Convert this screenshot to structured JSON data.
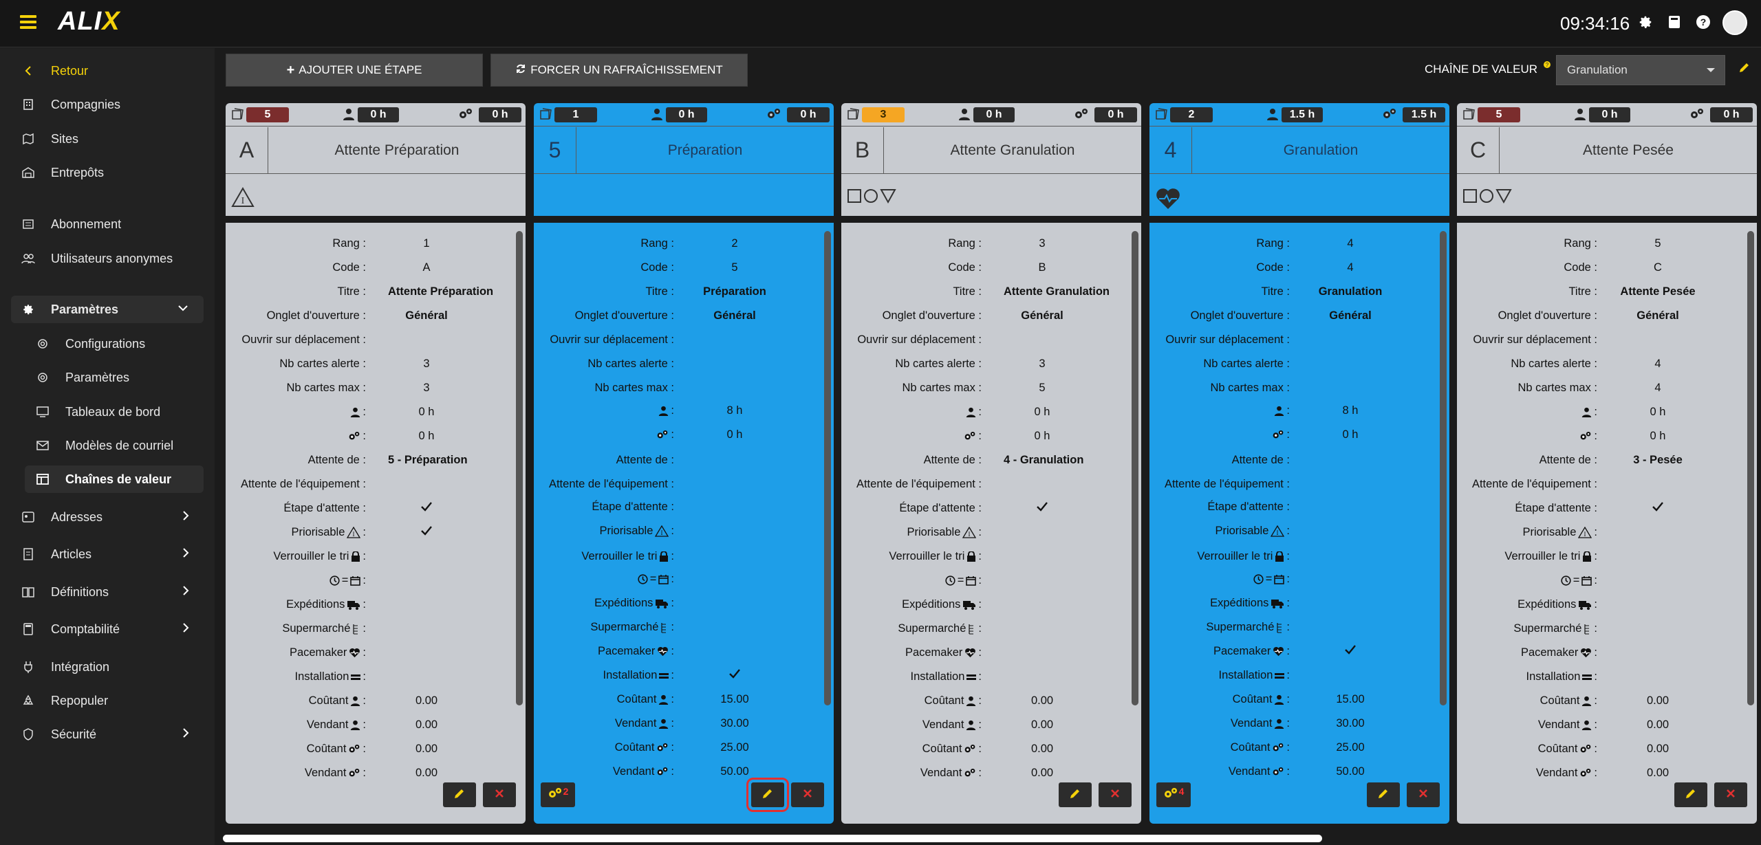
{
  "header": {
    "time": "09:34:16",
    "logo": "ALIX"
  },
  "sidebar": {
    "back": "Retour",
    "items": [
      {
        "label": "Compagnies",
        "icon": "building-icon"
      },
      {
        "label": "Sites",
        "icon": "map-icon"
      },
      {
        "label": "Entrepôts",
        "icon": "warehouse-icon"
      },
      {
        "label": "Abonnement",
        "icon": "list-icon"
      },
      {
        "label": "Utilisateurs anonymes",
        "icon": "users-icon"
      },
      {
        "label": "Paramètres",
        "icon": "gear-icon"
      },
      {
        "label": "Configurations",
        "icon": "gear-outline-icon"
      },
      {
        "label": "Paramètres",
        "icon": "gear-outline-icon"
      },
      {
        "label": "Tableaux de bord",
        "icon": "dashboard-icon"
      },
      {
        "label": "Modèles de courriel",
        "icon": "mail-icon"
      },
      {
        "label": "Chaînes de valeur",
        "icon": "table-icon"
      },
      {
        "label": "Adresses",
        "icon": "address-icon"
      },
      {
        "label": "Articles",
        "icon": "article-icon"
      },
      {
        "label": "Définitions",
        "icon": "book-icon"
      },
      {
        "label": "Comptabilité",
        "icon": "calculator-icon"
      },
      {
        "label": "Intégration",
        "icon": "plug-icon"
      },
      {
        "label": "Repopuler",
        "icon": "recycle-icon"
      },
      {
        "label": "Sécurité",
        "icon": "shield-icon"
      }
    ]
  },
  "toolbar": {
    "add_step": "AJOUTER UNE ÉTAPE",
    "refresh": "FORCER UN RAFRAÎCHISSEMENT",
    "chain_label": "CHAÎNE DE VALEUR",
    "chain_value": "Granulation"
  },
  "labels": {
    "rang": "Rang :",
    "code": "Code :",
    "titre": "Titre :",
    "onglet": "Onglet d'ouverture :",
    "ouvrir": "Ouvrir sur déplacement :",
    "alerte": "Nb cartes alerte :",
    "max": "Nb cartes max :",
    "colon": ":",
    "attente_de": "Attente de :",
    "attente_equip": "Attente de l'équipement :",
    "etape_attente": "Étape d'attente :",
    "priorisable": "Priorisable",
    "verrouiller": "Verrouiller le tri",
    "eq": "=",
    "expeditions": "Expéditions",
    "supermarche": "Supermarché",
    "pacemaker": "Pacemaker",
    "installation": "Installation",
    "coutant": "Coûtant",
    "vendant": "Vendant"
  },
  "columns": [
    {
      "badge": "5",
      "person_time": "0 h",
      "machine_time": "0 h",
      "code": "A",
      "title": "Attente Préparation",
      "rang": "1",
      "code_val": "A",
      "titre": "Attente Préparation",
      "onglet": "Général",
      "alerte": "3",
      "max": "3",
      "person": "0 h",
      "machine": "0 h",
      "attente_de": "5 - Préparation",
      "etape_attente": "✓",
      "priorisable": "✓",
      "pacemaker": "",
      "installation": "",
      "coutant_p": "0.00",
      "vendant_p": "0.00",
      "coutant_m": "0.00",
      "vendant_m": "0.00"
    },
    {
      "badge": "1",
      "person_time": "0 h",
      "machine_time": "0 h",
      "code": "5",
      "title": "Préparation",
      "rang": "2",
      "code_val": "5",
      "titre": "Préparation",
      "onglet": "Général",
      "alerte": "",
      "max": "",
      "person": "8 h",
      "machine": "0 h",
      "attente_de": "",
      "etape_attente": "",
      "priorisable": "",
      "pacemaker": "",
      "installation": "✓",
      "coutant_p": "15.00",
      "vendant_p": "30.00",
      "coutant_m": "25.00",
      "vendant_m": "50.00",
      "gear_count": "2"
    },
    {
      "badge": "3",
      "person_time": "0 h",
      "machine_time": "0 h",
      "code": "B",
      "title": "Attente Granulation",
      "rang": "3",
      "code_val": "B",
      "titre": "Attente Granulation",
      "onglet": "Général",
      "alerte": "3",
      "max": "5",
      "person": "0 h",
      "machine": "0 h",
      "attente_de": "4 - Granulation",
      "etape_attente": "✓",
      "priorisable": "",
      "pacemaker": "",
      "installation": "",
      "coutant_p": "0.00",
      "vendant_p": "0.00",
      "coutant_m": "0.00",
      "vendant_m": "0.00"
    },
    {
      "badge": "2",
      "person_time": "1.5 h",
      "machine_time": "1.5 h",
      "code": "4",
      "title": "Granulation",
      "rang": "4",
      "code_val": "4",
      "titre": "Granulation",
      "onglet": "Général",
      "alerte": "",
      "max": "",
      "person": "8 h",
      "machine": "0 h",
      "attente_de": "",
      "etape_attente": "",
      "priorisable": "",
      "pacemaker": "✓",
      "installation": "",
      "coutant_p": "15.00",
      "vendant_p": "30.00",
      "coutant_m": "25.00",
      "vendant_m": "50.00",
      "gear_count": "4"
    },
    {
      "badge": "5",
      "person_time": "0 h",
      "machine_time": "0 h",
      "code": "C",
      "title": "Attente Pesée",
      "rang": "5",
      "code_val": "C",
      "titre": "Attente Pesée",
      "onglet": "Général",
      "alerte": "4",
      "max": "4",
      "person": "0 h",
      "machine": "0 h",
      "attente_de": "3 - Pesée",
      "etape_attente": "✓",
      "priorisable": "",
      "pacemaker": "",
      "installation": "",
      "coutant_p": "0.00",
      "vendant_p": "0.00",
      "coutant_m": "0.00",
      "vendant_m": "0.00"
    }
  ],
  "colors": {
    "accent": "#f5d20a",
    "blue": "#1e9ee8",
    "grey": "#c8cbd0",
    "badge_red": "#7b2d2d",
    "badge_orange": "#f5a623"
  }
}
